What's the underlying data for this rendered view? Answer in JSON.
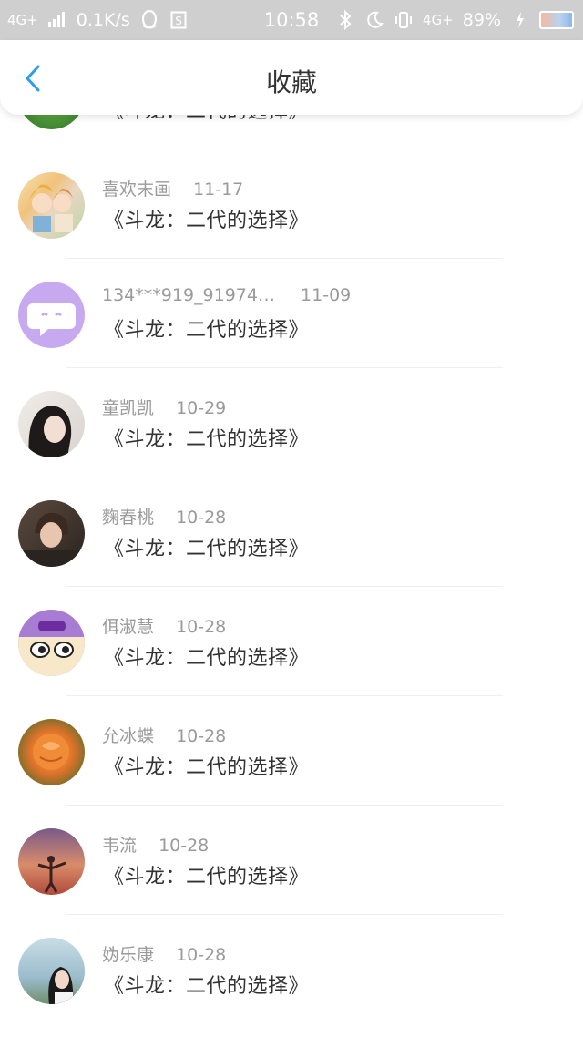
{
  "status_bar": {
    "network": "4G+",
    "speed": "0.1K/s",
    "time": "10:58",
    "network2": "4G+",
    "battery": "89%"
  },
  "header": {
    "title": "收藏"
  },
  "items": [
    {
      "name": "",
      "date": "",
      "title": "《斗龙：二代的选择》"
    },
    {
      "name": "喜欢末画",
      "date": "11-17",
      "title": "《斗龙：二代的选择》"
    },
    {
      "name": "134***919_91974…",
      "date": "11-09",
      "title": "《斗龙：二代的选择》"
    },
    {
      "name": "童凯凯",
      "date": "10-29",
      "title": "《斗龙：二代的选择》"
    },
    {
      "name": "麴春桃",
      "date": "10-28",
      "title": "《斗龙：二代的选择》"
    },
    {
      "name": "佴淑慧",
      "date": "10-28",
      "title": "《斗龙：二代的选择》"
    },
    {
      "name": "允冰蝶",
      "date": "10-28",
      "title": "《斗龙：二代的选择》"
    },
    {
      "name": "韦流",
      "date": "10-28",
      "title": "《斗龙：二代的选择》"
    },
    {
      "name": "妫乐康",
      "date": "10-28",
      "title": "《斗龙：二代的选择》"
    }
  ],
  "colors": {
    "accent": "#2b9cf0",
    "text_primary": "#333333",
    "text_secondary": "#9a9a9a"
  }
}
